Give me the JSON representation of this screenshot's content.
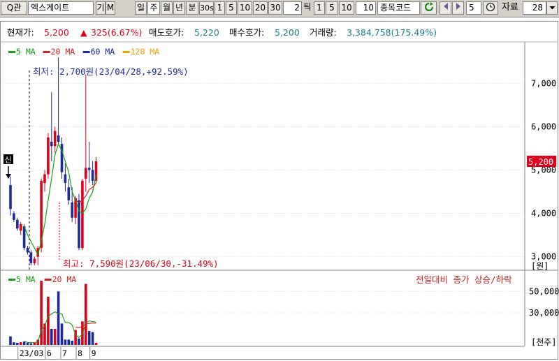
{
  "toolbar": {
    "search_btn": "Q관",
    "stock_name": "엑스게이트",
    "gi_label": "기",
    "m_label": "M",
    "periods": [
      "일",
      "주",
      "월",
      "년",
      "분",
      "30s"
    ],
    "active_period": "주",
    "minute_opts": [
      "1",
      "5",
      "10",
      "20",
      "30"
    ],
    "tick_value": "2",
    "tick_label": "틱",
    "tick_opts": [
      "1",
      "5",
      "10"
    ],
    "tick_count": "10",
    "code_label": "종목코드",
    "step_value": "5",
    "data_label": "자료",
    "data_count": "28"
  },
  "info": {
    "price_label": "현재가:",
    "price": "5,200",
    "change": "325(6.67%)",
    "ask_label": "매도호가:",
    "ask": "5,220",
    "bid_label": "매수호가:",
    "bid": "5,200",
    "volume_label": "거래량:",
    "volume": "3,384,758(175.49%)"
  },
  "chart_data": [
    {
      "type": "candlestick",
      "legend": [
        {
          "name": "5 MA",
          "color": "#14a014"
        },
        {
          "name": "20 MA",
          "color": "#d02020"
        },
        {
          "name": "60 MA",
          "color": "#1a2a9c"
        },
        {
          "name": "120 MA",
          "color": "#f0a000"
        }
      ],
      "ylim": [
        2800,
        7600
      ],
      "yticks": [
        3000,
        4000,
        5000,
        6000,
        7000
      ],
      "ytick_labels": [
        "3,000",
        "4,000",
        "5,000",
        "6,000",
        "7,000"
      ],
      "y_unit": "[원]",
      "current_price": 5200,
      "current_price_label": "5,200",
      "annotations": {
        "low": "최저: 2,700원(23/04/28,+92.59%)",
        "high": "최고: 7,590원(23/06/30,-31.49%)",
        "new_label": "신"
      },
      "candles": [
        {
          "o": 4650,
          "h": 4850,
          "l": 3950,
          "c": 4100
        },
        {
          "o": 4000,
          "h": 4050,
          "l": 3800,
          "c": 3850
        },
        {
          "o": 3850,
          "h": 3900,
          "l": 3600,
          "c": 3650
        },
        {
          "o": 3600,
          "h": 3800,
          "l": 3500,
          "c": 3750
        },
        {
          "o": 3700,
          "h": 3750,
          "l": 3150,
          "c": 3200
        },
        {
          "o": 3200,
          "h": 3250,
          "l": 3050,
          "c": 3100
        },
        {
          "o": 3100,
          "h": 3150,
          "l": 2800,
          "c": 2850
        },
        {
          "o": 2850,
          "h": 3000,
          "l": 2800,
          "c": 2950
        },
        {
          "o": 3000,
          "h": 3250,
          "l": 2800,
          "c": 3200
        },
        {
          "o": 3200,
          "h": 4800,
          "l": 3100,
          "c": 4750
        },
        {
          "o": 4700,
          "h": 5000,
          "l": 4500,
          "c": 4900
        },
        {
          "o": 4900,
          "h": 5850,
          "l": 4800,
          "c": 5750
        },
        {
          "o": 5650,
          "h": 6800,
          "l": 5200,
          "c": 5550
        },
        {
          "o": 5550,
          "h": 6000,
          "l": 5400,
          "c": 5900
        },
        {
          "o": 5800,
          "h": 7600,
          "l": 5600,
          "c": 5650
        },
        {
          "o": 5600,
          "h": 5750,
          "l": 4800,
          "c": 4950
        },
        {
          "o": 4900,
          "h": 5150,
          "l": 4500,
          "c": 4700
        },
        {
          "o": 4600,
          "h": 4800,
          "l": 4200,
          "c": 4300
        },
        {
          "o": 4250,
          "h": 4600,
          "l": 3800,
          "c": 3900
        },
        {
          "o": 3900,
          "h": 4400,
          "l": 3750,
          "c": 4350
        },
        {
          "o": 4300,
          "h": 4450,
          "l": 3150,
          "c": 3200
        },
        {
          "o": 3200,
          "h": 4800,
          "l": 3150,
          "c": 4750
        },
        {
          "o": 4800,
          "h": 7200,
          "l": 4500,
          "c": 5050
        },
        {
          "o": 5050,
          "h": 5650,
          "l": 4700,
          "c": 5000
        },
        {
          "o": 5000,
          "h": 5200,
          "l": 4650,
          "c": 4750
        },
        {
          "o": 4750,
          "h": 5300,
          "l": 4700,
          "c": 5200
        }
      ],
      "ma5": [
        null,
        null,
        null,
        null,
        3700,
        3500,
        3350,
        3200,
        3050,
        3350,
        3750,
        4300,
        4800,
        5350,
        5600,
        5450,
        5200,
        4950,
        4500,
        4300,
        4050,
        4000,
        4100,
        4350,
        4500,
        4900
      ],
      "ma20": [
        null,
        null,
        null,
        null,
        null,
        null,
        null,
        null,
        null,
        null,
        null,
        null,
        null,
        null,
        null,
        null,
        null,
        null,
        null,
        4300,
        4250,
        4300,
        4400,
        4550,
        4600,
        4700
      ]
    },
    {
      "type": "bar",
      "legend": [
        {
          "name": "5 MA",
          "color": "#14a014"
        },
        {
          "name": "20 MA",
          "color": "#d02020"
        }
      ],
      "note": "전일대비 종가 상승/하락",
      "ylim": [
        0,
        60000
      ],
      "yticks": [
        30000,
        50000
      ],
      "ytick_labels": [
        "30,000",
        "50,000"
      ],
      "y_unit": "[천주]",
      "volumes": [
        8000,
        2500,
        2000,
        2500,
        3000,
        2000,
        1500,
        2500,
        5000,
        60000,
        20000,
        45000,
        15000,
        15000,
        50000,
        20000,
        5000,
        5000,
        4000,
        14000,
        6000,
        22000,
        57000,
        13000,
        12000,
        2000
      ],
      "ma5": [
        null,
        null,
        null,
        null,
        3600,
        2400,
        2200,
        2300,
        2800,
        13800,
        17800,
        26600,
        29000,
        31000,
        29000,
        29000,
        21000,
        21000,
        18800,
        9600,
        6800,
        10200,
        20600,
        22400,
        22000,
        21200
      ],
      "ma20": [
        null,
        null,
        null,
        null,
        null,
        null,
        null,
        null,
        null,
        null,
        null,
        null,
        null,
        null,
        null,
        null,
        null,
        null,
        null,
        16500,
        16100,
        17000,
        19800,
        20100,
        20500,
        20400
      ],
      "x_labels": [
        {
          "label": "23/03",
          "i": 3
        },
        {
          "label": "6",
          "i": 11
        },
        {
          "label": "7",
          "i": 15.5
        },
        {
          "label": "8",
          "i": 20
        },
        {
          "label": "9",
          "i": 24
        }
      ]
    }
  ]
}
